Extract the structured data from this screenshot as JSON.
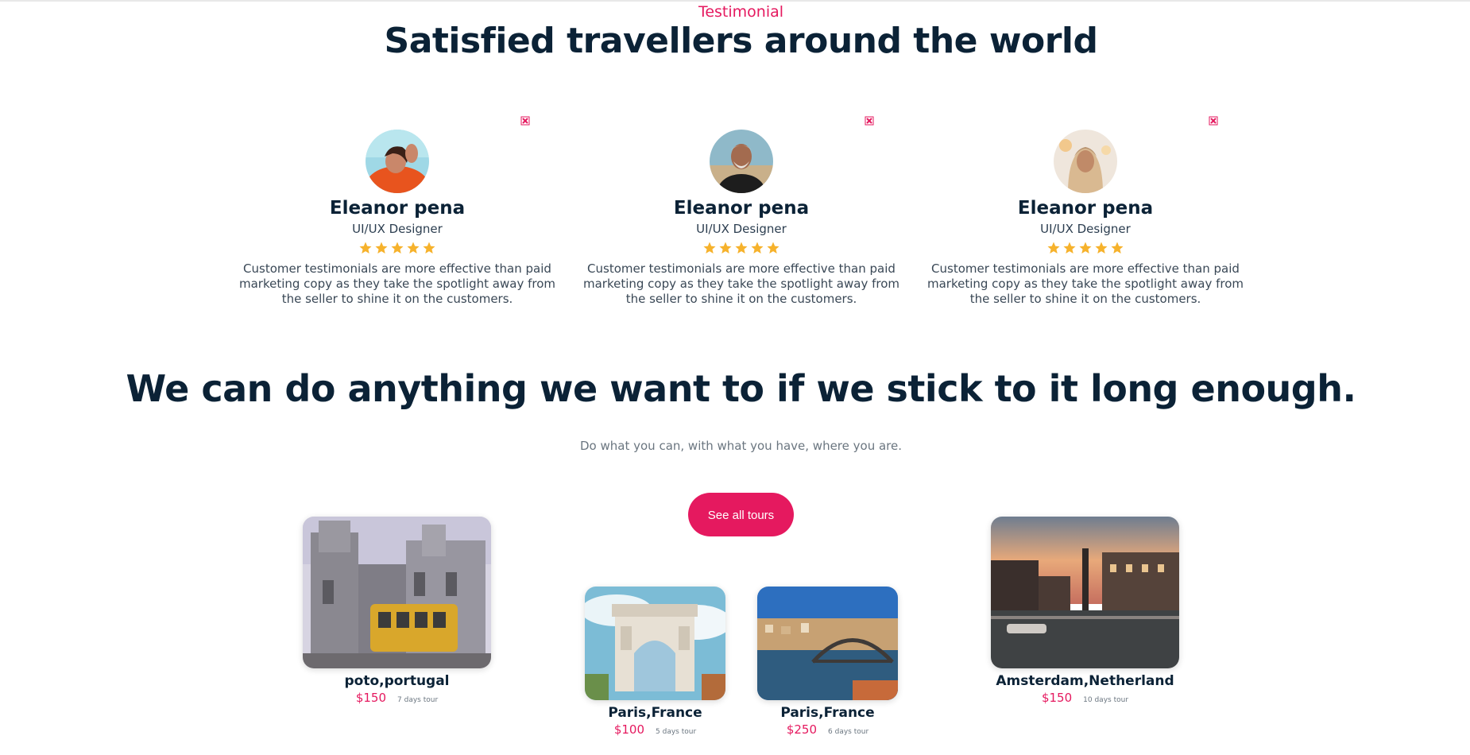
{
  "testimonial_section": {
    "kicker": "Testimonial",
    "heading": "Satisfied travellers around the world",
    "cards": [
      {
        "name": "Eleanor pena",
        "role": "UI/UX Designer",
        "rating": 5,
        "text": "Customer testimonials are more effective than paid marketing copy as they take the spotlight away from the seller to shine it on the customers."
      },
      {
        "name": "Eleanor pena",
        "role": "UI/UX Designer",
        "rating": 5,
        "text": "Customer testimonials are more effective than paid marketing copy as they take the spotlight away from the seller to shine it on the customers."
      },
      {
        "name": "Eleanor pena",
        "role": "UI/UX Designer",
        "rating": 5,
        "text": "Customer testimonials are more effective than paid marketing copy as they take the spotlight away from the seller to shine it on the customers."
      }
    ]
  },
  "tours_section": {
    "heading": "We can do anything we want to if we stick to it long enough.",
    "subheading": "Do what you can, with what you have, where you are.",
    "button_label": "See all tours",
    "tours": [
      {
        "name": "poto,portugal",
        "price": "$150",
        "duration": "7 days tour"
      },
      {
        "name": "Paris,France",
        "price": "$100",
        "duration": "5 days tour"
      },
      {
        "name": "Paris,France",
        "price": "$250",
        "duration": "6 days tour"
      },
      {
        "name": "Amsterdam,Netherland",
        "price": "$150",
        "duration": "10 days tour"
      }
    ]
  },
  "colors": {
    "accent": "#e5195f",
    "heading": "#0b2236",
    "star": "#f6b22c"
  }
}
